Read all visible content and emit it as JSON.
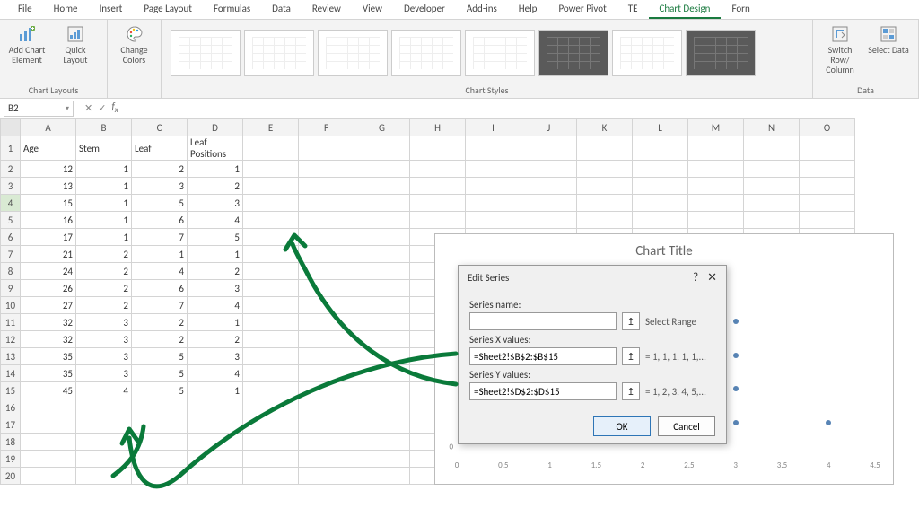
{
  "ribbon": {
    "tabs": [
      "File",
      "Home",
      "Insert",
      "Page Layout",
      "Formulas",
      "Data",
      "Review",
      "View",
      "Developer",
      "Add-ins",
      "Help",
      "Power Pivot",
      "TE",
      "Chart Design",
      "Forn"
    ],
    "active_tab": "Chart Design",
    "groups": {
      "chart_layouts": {
        "label": "Chart Layouts",
        "add_chart_element": "Add Chart Element",
        "quick_layout": "Quick Layout",
        "change_colors": "Change Colors"
      },
      "chart_styles": {
        "label": "Chart Styles"
      },
      "data": {
        "label": "Data",
        "switch": "Switch Row/ Column",
        "select": "Select Data"
      }
    }
  },
  "name_box": "B2",
  "columns": [
    "A",
    "B",
    "C",
    "D",
    "E",
    "F",
    "G",
    "H",
    "I",
    "J",
    "K",
    "L",
    "M",
    "N",
    "O"
  ],
  "headers": {
    "A": "Age",
    "B": "Stem",
    "C": "Leaf",
    "D": "Leaf Positions"
  },
  "rows": [
    {
      "r": 2,
      "A": 12,
      "B": 1,
      "C": 2,
      "D": 1
    },
    {
      "r": 3,
      "A": 13,
      "B": 1,
      "C": 3,
      "D": 2
    },
    {
      "r": 4,
      "A": 15,
      "B": 1,
      "C": 5,
      "D": 3
    },
    {
      "r": 5,
      "A": 16,
      "B": 1,
      "C": 6,
      "D": 4
    },
    {
      "r": 6,
      "A": 17,
      "B": 1,
      "C": 7,
      "D": 5
    },
    {
      "r": 7,
      "A": 21,
      "B": 2,
      "C": 1,
      "D": 1
    },
    {
      "r": 8,
      "A": 24,
      "B": 2,
      "C": 4,
      "D": 2
    },
    {
      "r": 9,
      "A": 26,
      "B": 2,
      "C": 6,
      "D": 3
    },
    {
      "r": 10,
      "A": 27,
      "B": 2,
      "C": 7,
      "D": 4
    },
    {
      "r": 11,
      "A": 32,
      "B": 3,
      "C": 2,
      "D": 1
    },
    {
      "r": 12,
      "A": 32,
      "B": 3,
      "C": 2,
      "D": 2
    },
    {
      "r": 13,
      "A": 35,
      "B": 3,
      "C": 5,
      "D": 3
    },
    {
      "r": 14,
      "A": 35,
      "B": 3,
      "C": 5,
      "D": 4
    },
    {
      "r": 15,
      "A": 45,
      "B": 4,
      "C": 5,
      "D": 1
    }
  ],
  "chart": {
    "title": "Chart Title",
    "x_ticks": [
      "0",
      "0.5",
      "1",
      "1.5",
      "2",
      "2.5",
      "3",
      "3.5",
      "4",
      "4.5"
    ],
    "y_ticks": [
      "0"
    ]
  },
  "chart_data": {
    "type": "scatter",
    "title": "Chart Title",
    "xlabel": "",
    "ylabel": "",
    "xlim": [
      0,
      4.5
    ],
    "x_name": "Stem",
    "y_name": "Leaf Positions",
    "x": [
      1,
      1,
      1,
      1,
      1,
      2,
      2,
      2,
      2,
      3,
      3,
      3,
      3,
      4
    ],
    "y": [
      1,
      2,
      3,
      4,
      5,
      1,
      2,
      3,
      4,
      1,
      2,
      3,
      4,
      1
    ]
  },
  "dialog": {
    "title": "Edit Series",
    "series_name_label": "Series name:",
    "series_name_value": "",
    "series_name_hint": "Select Range",
    "series_x_label": "Series X values:",
    "series_x_value": "=Sheet2!$B$2:$B$15",
    "series_x_hint": "= 1, 1, 1, 1, 1,...",
    "series_y_label": "Series Y values:",
    "series_y_value": "=Sheet2!$D$2:$D$15",
    "series_y_hint": "= 1, 2, 3, 4, 5,...",
    "ok": "OK",
    "cancel": "Cancel"
  }
}
